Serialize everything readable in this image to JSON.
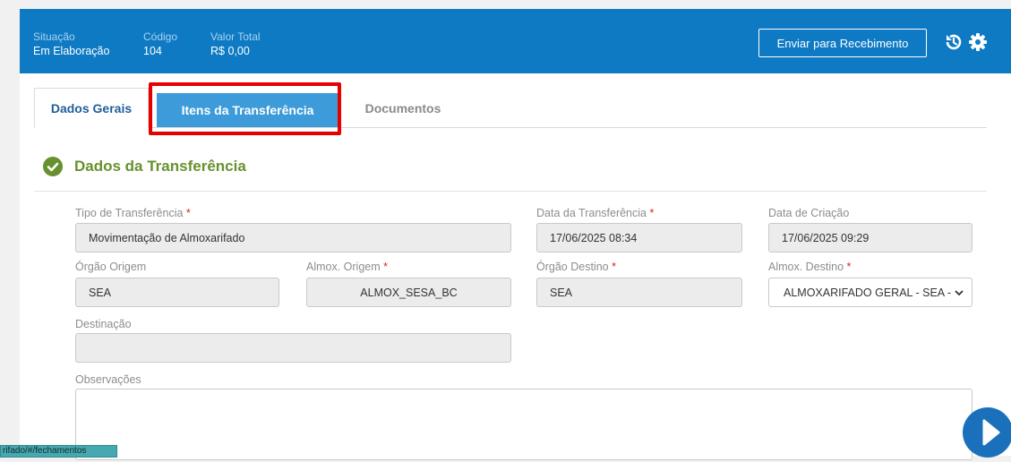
{
  "header": {
    "situacao_label": "Situação",
    "situacao_value": "Em Elaboração",
    "codigo_label": "Código",
    "codigo_value": "104",
    "valor_label": "Valor Total",
    "valor_value": "R$ 0,00",
    "send_button": "Enviar para Recebimento",
    "icons": [
      "history-icon",
      "gear-icon"
    ]
  },
  "tabs": [
    {
      "label": "Dados Gerais"
    },
    {
      "label": "Itens da Transferência"
    },
    {
      "label": "Documentos"
    }
  ],
  "section": {
    "title": "Dados da Transferência",
    "icon": "check-circle-icon"
  },
  "form": {
    "tipo_label": "Tipo de Transferência",
    "tipo_value": "Movimentação de Almoxarifado",
    "data_transf_label": "Data da Transferência",
    "data_transf_value": "17/06/2025 08:34",
    "data_criacao_label": "Data de Criação",
    "data_criacao_value": "17/06/2025 09:29",
    "orgao_origem_label": "Órgão Origem",
    "orgao_origem_value": "SEA",
    "almox_origem_label": "Almox. Origem",
    "almox_origem_value": "ALMOX_SESA_BC",
    "orgao_destino_label": "Órgão Destino",
    "orgao_destino_value": "SEA",
    "almox_destino_label": "Almox. Destino",
    "almox_destino_value": "ALMOXARIFADO GERAL - SEA -",
    "destinacao_label": "Destinação",
    "destinacao_value": "",
    "observacoes_label": "Observações",
    "observacoes_value": "",
    "required_mark": "*"
  },
  "status_url": "rifado/#/fechamentos",
  "colors": {
    "header_bg": "#0e7ac4",
    "active_tab": "#3c9bd8",
    "highlight": "#e60000",
    "section_green": "#67912e"
  }
}
